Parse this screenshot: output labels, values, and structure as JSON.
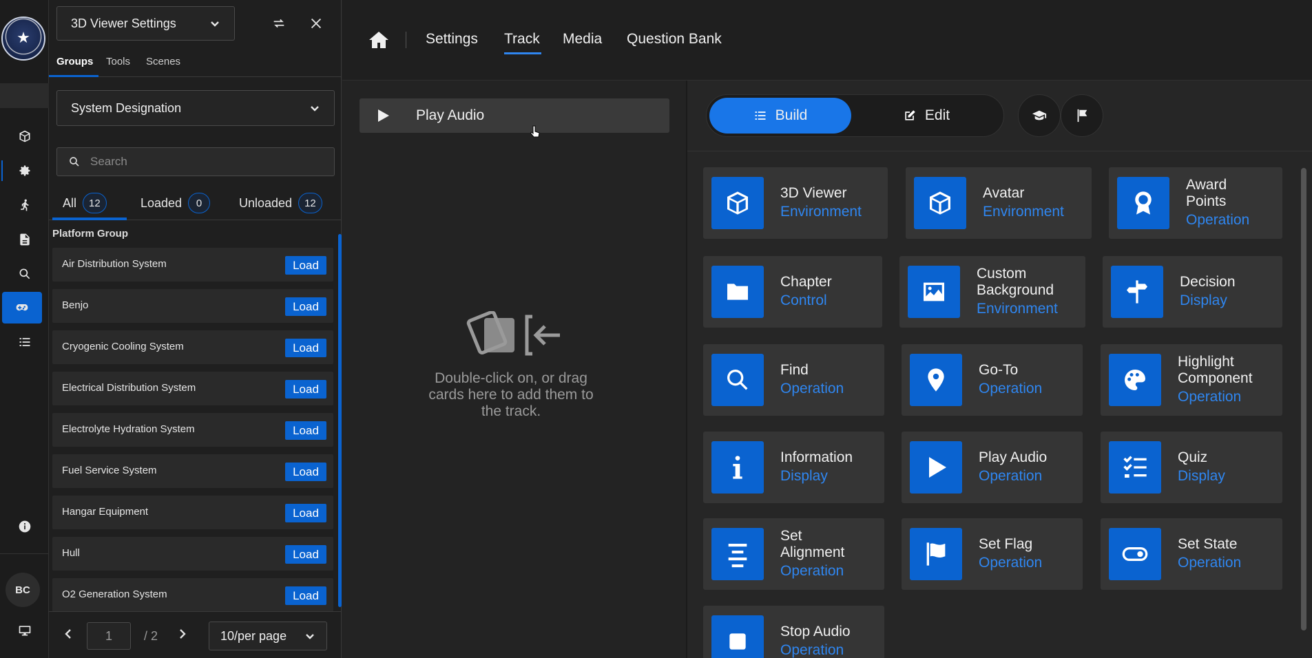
{
  "panel": {
    "viewer_dropdown": "3D Viewer Settings",
    "tabs": [
      "Groups",
      "Tools",
      "Scenes"
    ],
    "designation_dropdown": "System Designation",
    "search_placeholder": "Search",
    "filters": [
      {
        "label": "All",
        "count": "12"
      },
      {
        "label": "Loaded",
        "count": "0"
      },
      {
        "label": "Unloaded",
        "count": "12"
      }
    ],
    "group_title": "Platform Group",
    "items": [
      "Air Distribution System",
      "Benjo",
      "Cryogenic Cooling System",
      "Electrical Distribution System",
      "Electrolyte Hydration System",
      "Fuel Service System",
      "Hangar Equipment",
      "Hull",
      "O2 Generation System"
    ],
    "load_label": "Load",
    "pager": {
      "page": "1",
      "total": "/ 2",
      "per_page": "10/per page"
    }
  },
  "user": {
    "initials": "BC"
  },
  "nav": {
    "items": [
      "Settings",
      "Track",
      "Media",
      "Question Bank"
    ],
    "active": "Track"
  },
  "track": {
    "card_label": "Play Audio",
    "empty_text": "Double-click on, or drag cards here to add them to the track."
  },
  "toolbar": {
    "build_label": "Build",
    "edit_label": "Edit"
  },
  "cards": [
    {
      "title": "3D Viewer",
      "sub": "Environment",
      "icon": "cube-icon"
    },
    {
      "title": "Avatar",
      "sub": "Environment",
      "icon": "cube-icon"
    },
    {
      "title": "Award Points",
      "sub": "Operation",
      "icon": "award-icon"
    },
    {
      "title": "Chapter",
      "sub": "Control",
      "icon": "folder-icon"
    },
    {
      "title": "Custom Background",
      "sub": "Environment",
      "icon": "image-icon"
    },
    {
      "title": "Decision",
      "sub": "Display",
      "icon": "signpost-icon"
    },
    {
      "title": "Find",
      "sub": "Operation",
      "icon": "search-icon"
    },
    {
      "title": "Go-To",
      "sub": "Operation",
      "icon": "location-pin-icon"
    },
    {
      "title": "Highlight Component",
      "sub": "Operation",
      "icon": "palette-icon"
    },
    {
      "title": "Information",
      "sub": "Display",
      "icon": "info-icon"
    },
    {
      "title": "Play Audio",
      "sub": "Operation",
      "icon": "play-icon"
    },
    {
      "title": "Quiz",
      "sub": "Display",
      "icon": "checklist-icon"
    },
    {
      "title": "Set Alignment",
      "sub": "Operation",
      "icon": "align-center-icon"
    },
    {
      "title": "Set Flag",
      "sub": "Operation",
      "icon": "flag-icon"
    },
    {
      "title": "Set State",
      "sub": "Operation",
      "icon": "toggle-icon"
    },
    {
      "title": "Stop Audio",
      "sub": "Operation",
      "icon": "stop-icon"
    }
  ],
  "colors": {
    "accent": "#0a63d0",
    "accent_text": "#2f86f0",
    "background": "#232323"
  }
}
